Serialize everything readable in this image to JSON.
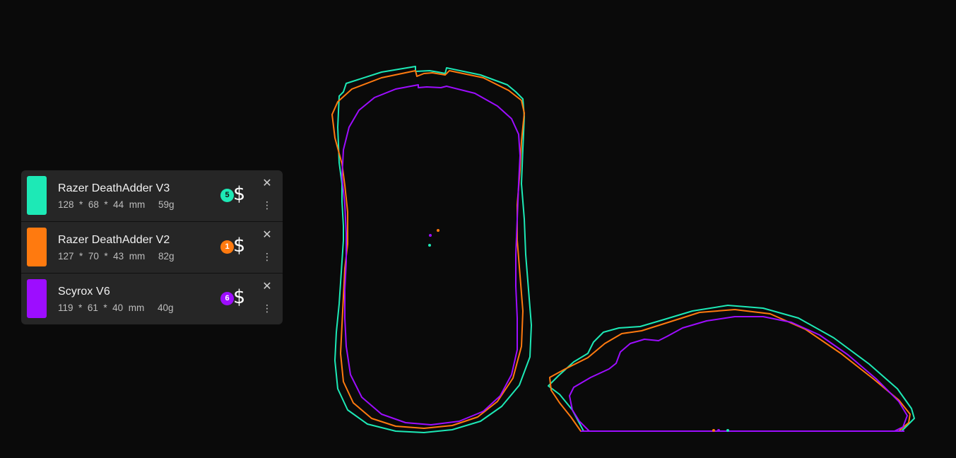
{
  "mice": [
    {
      "name": "Razer DeathAdder V3",
      "length": "128",
      "width": "68",
      "height": "44",
      "unit": "mm",
      "weight": "59g",
      "rank": "5",
      "color": "#1de9b6",
      "badge_dark_text": false
    },
    {
      "name": "Razer DeathAdder V2",
      "length": "127",
      "width": "70",
      "height": "43",
      "unit": "mm",
      "weight": "82g",
      "rank": "1",
      "color": "#ff7a0f",
      "badge_dark_text": true
    },
    {
      "name": "Scyrox V6",
      "length": "119",
      "width": "61",
      "height": "40",
      "unit": "mm",
      "weight": "40g",
      "rank": "6",
      "color": "#9d0dff",
      "badge_dark_text": true
    }
  ],
  "labels": {
    "separator": "*",
    "price_symbol": "$",
    "close_glyph": "✕",
    "more_glyph": "⋮"
  },
  "icons": {
    "close": "close-icon",
    "more": "more-vertical-icon",
    "price": "dollar-icon"
  },
  "canvas_background": "#0a0a0a",
  "panel_background": "#262626"
}
